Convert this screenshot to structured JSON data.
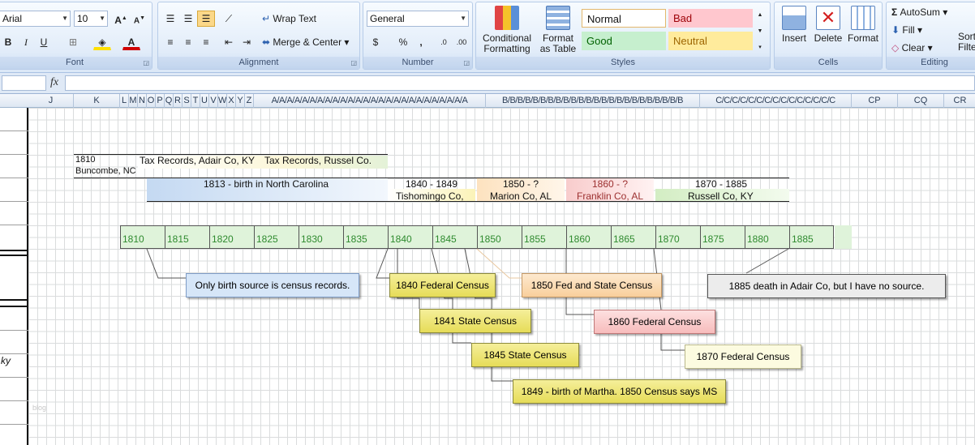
{
  "ribbon": {
    "font": {
      "name": "Arial",
      "size": "10",
      "label": "Font"
    },
    "alignment": {
      "wrap_text": "Wrap Text",
      "merge_center": "Merge & Center",
      "label": "Alignment"
    },
    "number": {
      "format": "General",
      "currency": "$",
      "percent": "%",
      "comma": ",",
      "label": "Number"
    },
    "styles": {
      "conditional": "Conditional Formatting",
      "format_table": "Format as Table",
      "normal": "Normal",
      "bad": "Bad",
      "good": "Good",
      "neutral": "Neutral",
      "label": "Styles"
    },
    "cells": {
      "insert": "Insert",
      "delete": "Delete",
      "format": "Format",
      "label": "Cells"
    },
    "editing": {
      "autosum": "AutoSum",
      "fill": "Fill",
      "clear": "Clear",
      "sort_filter": "Sort & Filte",
      "label": "Editing"
    }
  },
  "formula_bar": {
    "fx": "fx"
  },
  "columns": [
    {
      "label": "J"
    },
    {
      "label": "K"
    },
    {
      "label": "L"
    },
    {
      "label": "M"
    },
    {
      "label": "N"
    },
    {
      "label": "O"
    },
    {
      "label": "P"
    },
    {
      "label": "Q"
    },
    {
      "label": "R"
    },
    {
      "label": "S"
    },
    {
      "label": "T"
    },
    {
      "label": "U"
    },
    {
      "label": "V"
    },
    {
      "label": "W"
    },
    {
      "label": "X"
    },
    {
      "label": "Y"
    },
    {
      "label": "Z"
    },
    {
      "label": "A/A/A/A/A/A/A/A/A/A/A/A/A/A/A/A/A/A/A/A/A/A/A/A/A/A"
    },
    {
      "label": "B/B/B/B/B/B/B/B/B/B/B/B/B/B/B/B/B/B/B/B/B/B/B/B"
    },
    {
      "label": "C/C/C/C/C/C/C/C/C/C/C/C/C/C/C"
    },
    {
      "label": "CP"
    },
    {
      "label": "CQ"
    },
    {
      "label": "CR"
    }
  ],
  "sheet": {
    "left_fragment": "ky",
    "watermark": "blog",
    "header_row1": {
      "c1_line1": "1810",
      "c1_line2": "Buncombe, NC",
      "c2": "Tax Records, Adair Co, KY",
      "c3": "Tax Records, Russel Co."
    },
    "header_row2": {
      "birth": "1813 - birth in North Carolina",
      "p1_years": "1840 - 1849",
      "p1_place": "Tishomingo Co,",
      "p2_years": "1850 - ?",
      "p2_place": "Marion Co, AL",
      "p3_years": "1860 - ?",
      "p3_place": "Franklin Co, AL",
      "p4_years": "1870 - 1885",
      "p4_place": "Russell Co, KY"
    },
    "timeline": [
      "1810",
      "1815",
      "1820",
      "1825",
      "1830",
      "1835",
      "1840",
      "1845",
      "1850",
      "1855",
      "1860",
      "1865",
      "1870",
      "1875",
      "1880",
      "1885"
    ],
    "notes": {
      "birth_source": "Only birth source is census records.",
      "fed_1840": "1840 Federal Census",
      "fed_state_1850": "1850 Fed and State Census",
      "death_1885": "1885 death in Adair Co, but I have no source.",
      "state_1841": "1841 State Census",
      "fed_1860": "1860 Federal Census",
      "state_1845": "1845 State Census",
      "fed_1870": "1870 Federal Census",
      "birth_martha": "1849 - birth of Martha.  1850 Census says MS"
    }
  },
  "colors": {
    "tl_fill": "#dff3da",
    "tl_text": "#2e8a2e",
    "band_blue": "#c5daf3",
    "band_yellow": "#fdf6c3",
    "band_orange": "#fde5c6",
    "band_red": "#f9d5d5",
    "band_green": "#ddf0cf"
  }
}
